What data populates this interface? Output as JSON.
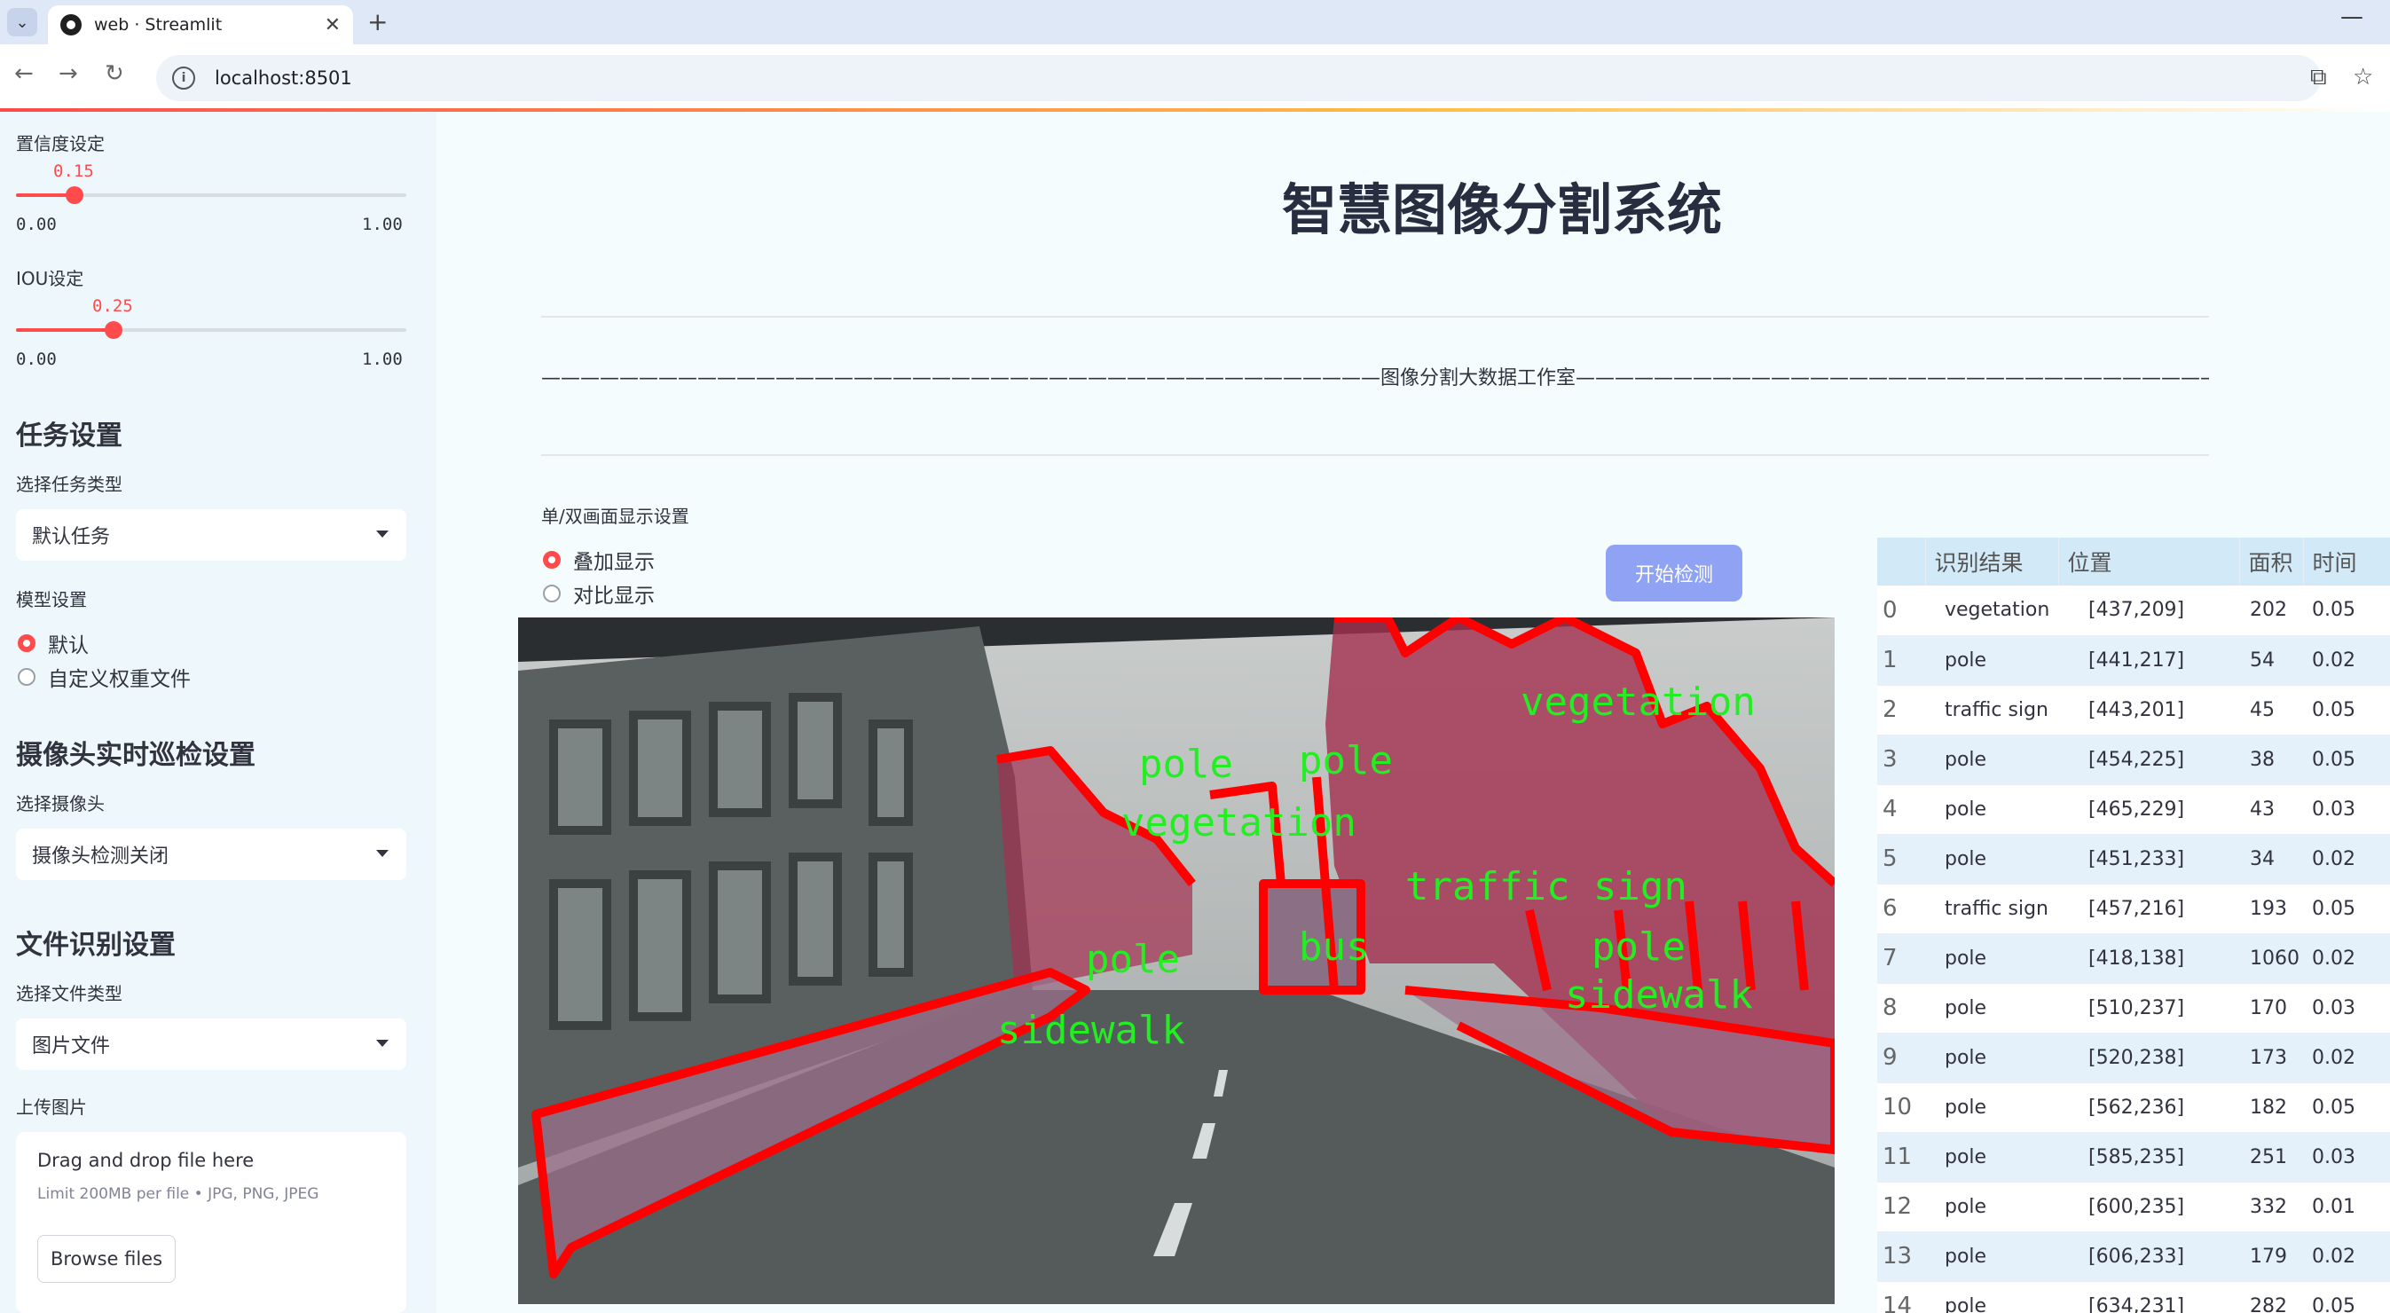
{
  "browser": {
    "tab_title": "web · Streamlit",
    "url": "localhost:8501"
  },
  "sidebar": {
    "confidence": {
      "label": "置信度设定",
      "value": "0.15",
      "min": "0.00",
      "max": "1.00",
      "fraction": 0.15
    },
    "iou": {
      "label": "IOU设定",
      "value": "0.25",
      "min": "0.00",
      "max": "1.00",
      "fraction": 0.25
    },
    "task_heading": "任务设置",
    "task_type_label": "选择任务类型",
    "task_type_value": "默认任务",
    "model_label": "模型设置",
    "model_options": [
      "默认",
      "自定义权重文件"
    ],
    "model_selected": 0,
    "camera_heading": "摄像头实时巡检设置",
    "camera_label": "选择摄像头",
    "camera_value": "摄像头检测关闭",
    "file_heading": "文件识别设置",
    "file_type_label": "选择文件类型",
    "file_type_value": "图片文件",
    "upload_label": "上传图片",
    "upload_title": "Drag and drop file here",
    "upload_limit": "Limit 200MB per file • JPG, PNG, JPEG",
    "upload_button": "Browse files"
  },
  "main": {
    "title": "智慧图像分割系统",
    "studio_line": "———————————————————————————————————————————图像分割大数据工作室—————————————————————————————————————————————",
    "display_label": "单/双画面显示设置",
    "display_options": [
      "叠加显示",
      "对比显示"
    ],
    "display_selected": 0,
    "detect_button": "开始检测"
  },
  "overlay_labels": [
    "vegetation",
    "pole",
    "pole",
    "vegetation",
    "traffic sign",
    "pole",
    "sidewalk",
    "sidewalk",
    "bus",
    "pole"
  ],
  "results": {
    "columns": [
      "",
      "识别结果",
      "位置",
      "面积",
      "时间"
    ],
    "rows": [
      [
        "0",
        "vegetation",
        "[437,209]",
        "202",
        "0.05"
      ],
      [
        "1",
        "pole",
        "[441,217]",
        "54",
        "0.02"
      ],
      [
        "2",
        "traffic sign",
        "[443,201]",
        "45",
        "0.05"
      ],
      [
        "3",
        "pole",
        "[454,225]",
        "38",
        "0.05"
      ],
      [
        "4",
        "pole",
        "[465,229]",
        "43",
        "0.03"
      ],
      [
        "5",
        "pole",
        "[451,233]",
        "34",
        "0.02"
      ],
      [
        "6",
        "traffic sign",
        "[457,216]",
        "193",
        "0.05"
      ],
      [
        "7",
        "pole",
        "[418,138]",
        "1060",
        "0.02"
      ],
      [
        "8",
        "pole",
        "[510,237]",
        "170",
        "0.03"
      ],
      [
        "9",
        "pole",
        "[520,238]",
        "173",
        "0.02"
      ],
      [
        "10",
        "pole",
        "[562,236]",
        "182",
        "0.05"
      ],
      [
        "11",
        "pole",
        "[585,235]",
        "251",
        "0.03"
      ],
      [
        "12",
        "pole",
        "[600,235]",
        "332",
        "0.01"
      ],
      [
        "13",
        "pole",
        "[606,233]",
        "179",
        "0.02"
      ],
      [
        "14",
        "pole",
        "[634,231]",
        "282",
        "0.05"
      ]
    ]
  },
  "colors": {
    "accent": "#ff4b4b",
    "mask_outline": "#ff0000",
    "label_text": "#22ee22",
    "button": "#8fa2f4"
  }
}
